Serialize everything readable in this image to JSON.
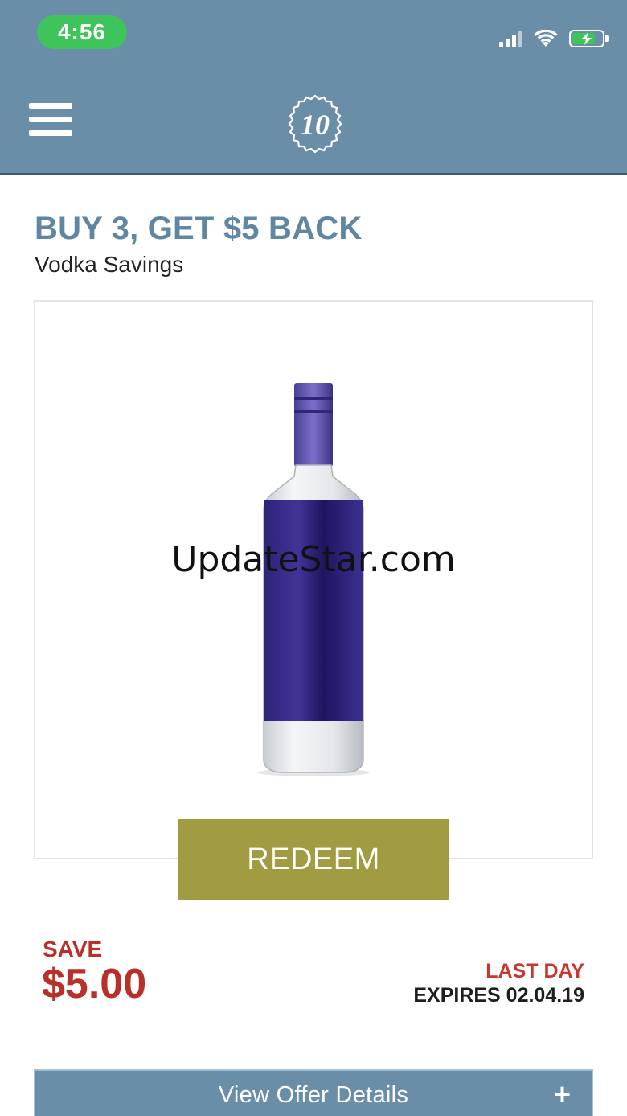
{
  "status_bar": {
    "time": "4:56",
    "icons": [
      "cellular-signal-icon",
      "wifi-icon",
      "battery-charging-icon"
    ]
  },
  "header": {
    "menu_icon": "hamburger-menu-icon",
    "logo_text": "10"
  },
  "offer": {
    "title": "BUY 3, GET $5 BACK",
    "subtitle": "Vodka Savings",
    "watermark": "UpdateStar.com",
    "redeem_label": "REDEEM",
    "save_label": "SAVE",
    "save_amount": "$5.00",
    "last_day": "LAST DAY",
    "expires": "EXPIRES 02.04.19"
  },
  "details": {
    "label": "View Offer Details",
    "toggle": "+"
  },
  "colors": {
    "header_bg": "#6a8ea7",
    "title": "#5f86a2",
    "redeem_bg": "#a19c42",
    "save_red": "#b9302b",
    "time_pill": "#3ec45a"
  }
}
